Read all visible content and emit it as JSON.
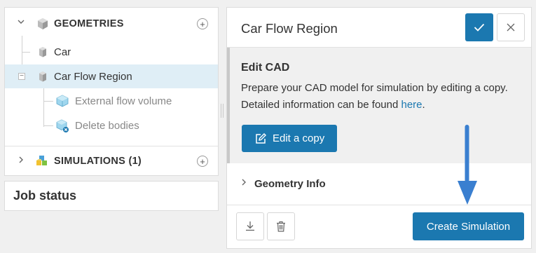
{
  "tree": {
    "geometries_label": "GEOMETRIES",
    "items": [
      {
        "label": "Car"
      },
      {
        "label": "Car Flow Region"
      },
      {
        "label": "External flow volume"
      },
      {
        "label": "Delete bodies"
      }
    ],
    "simulations_label": "SIMULATIONS (1)"
  },
  "job_status": {
    "title": "Job status"
  },
  "panel": {
    "title": "Car Flow Region",
    "edit_cad": {
      "heading": "Edit CAD",
      "description": "Prepare your CAD model for simulation by editing a copy. Detailed information can be found ",
      "link_text": "here",
      "period": ".",
      "button_label": "Edit a copy"
    },
    "geometry_info_label": "Geometry Info",
    "create_button_label": "Create Simulation"
  },
  "colors": {
    "accent": "#1b78b0",
    "selection": "#dfeef6",
    "annotation_arrow": "#3a7fd0"
  }
}
